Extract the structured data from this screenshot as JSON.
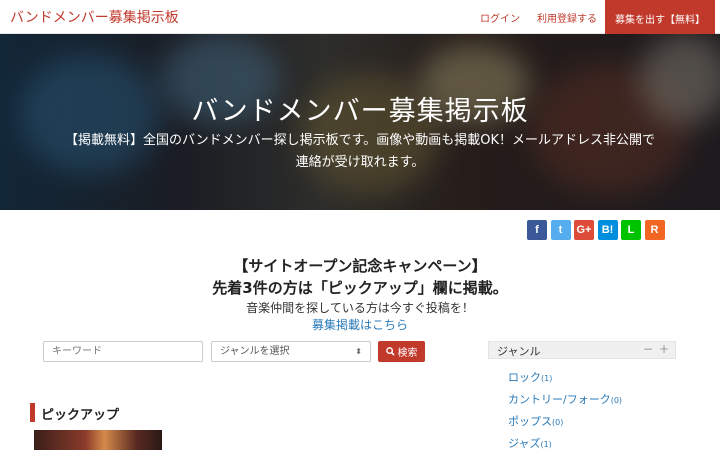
{
  "header": {
    "brand": "バンドメンバー募集掲示板",
    "login": "ログイン",
    "register": "利用登録する",
    "post_button": "募集を出す【無料】"
  },
  "hero": {
    "title": "バンドメンバー募集掲示板",
    "subtitle": "【掲載無料】全国のバンドメンバー探し掲示板です。画像や動画も掲載OK！メールアドレス非公開で連絡が受け取れます。"
  },
  "social": [
    {
      "icon": "facebook-icon",
      "glyph": "f",
      "color": "#3b5998"
    },
    {
      "icon": "twitter-icon",
      "glyph": "t",
      "color": "#55acee"
    },
    {
      "icon": "google-plus-icon",
      "glyph": "G+",
      "color": "#dd4b39"
    },
    {
      "icon": "hatena-bookmark-icon",
      "glyph": "B!",
      "color": "#008fde"
    },
    {
      "icon": "line-icon",
      "glyph": "L",
      "color": "#00c300"
    },
    {
      "icon": "rss-icon",
      "glyph": "R",
      "color": "#f26522"
    }
  ],
  "campaign": {
    "line1": "【サイトオープン記念キャンペーン】",
    "line2": "先着3件の方は「ピックアップ」欄に掲載。",
    "line3": "音楽仲間を探している方は今すぐ投稿を！",
    "link": "募集掲載はこちら"
  },
  "search": {
    "keyword_placeholder": "キーワード",
    "genre_select": "ジャンルを選択",
    "button": "検索"
  },
  "pickup": {
    "title": "ピックアップ"
  },
  "sidebar": {
    "title": "ジャンル",
    "controls": [
      "−",
      "+"
    ],
    "genres": [
      {
        "name": "ロック",
        "count": "(1)"
      },
      {
        "name": "カントリー/フォーク",
        "count": "(0)"
      },
      {
        "name": "ポップス",
        "count": "(0)"
      },
      {
        "name": "ジャズ",
        "count": "(1)"
      }
    ]
  }
}
